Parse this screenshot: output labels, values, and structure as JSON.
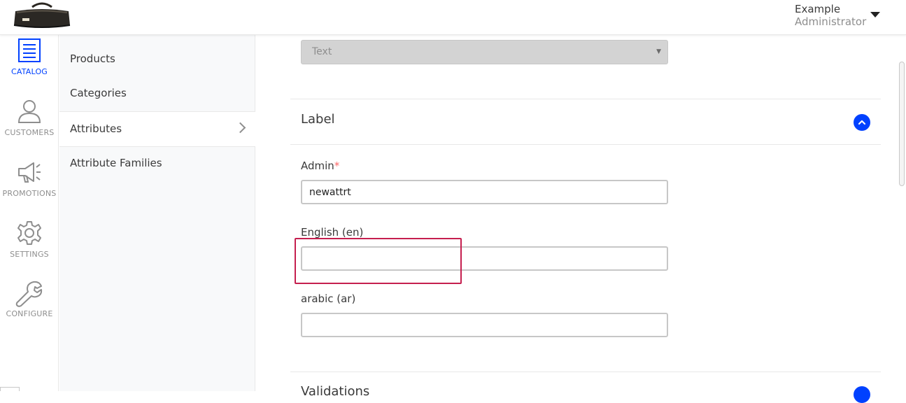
{
  "header": {
    "user_name": "Example",
    "user_role": "Administrator"
  },
  "nav": {
    "items": [
      {
        "label": "CATALOG",
        "icon": "catalog-icon",
        "active": true
      },
      {
        "label": "CUSTOMERS",
        "icon": "customers-icon"
      },
      {
        "label": "PROMOTIONS",
        "icon": "promotions-icon"
      },
      {
        "label": "SETTINGS",
        "icon": "settings-icon"
      },
      {
        "label": "CONFIGURE",
        "icon": "configure-icon"
      }
    ],
    "active_color": "#0041ff",
    "inactive_color": "#8e8e8e"
  },
  "subnav": {
    "items": [
      {
        "label": "Products"
      },
      {
        "label": "Categories"
      },
      {
        "label": "Attributes",
        "active": true
      },
      {
        "label": "Attribute Families"
      }
    ]
  },
  "form": {
    "type_select": {
      "value": "Text"
    },
    "label_section": {
      "title": "Label"
    },
    "fields": [
      {
        "label": "Admin",
        "required_mark": "*",
        "value": "newattrt"
      },
      {
        "label": "English (en)",
        "value": ""
      },
      {
        "label": "arabic (ar)",
        "value": ""
      }
    ],
    "next_section": {
      "title": "Validations"
    }
  },
  "colors": {
    "accent": "#0041ff",
    "highlight_box": "#c51f4f",
    "required": "#fc6868"
  }
}
